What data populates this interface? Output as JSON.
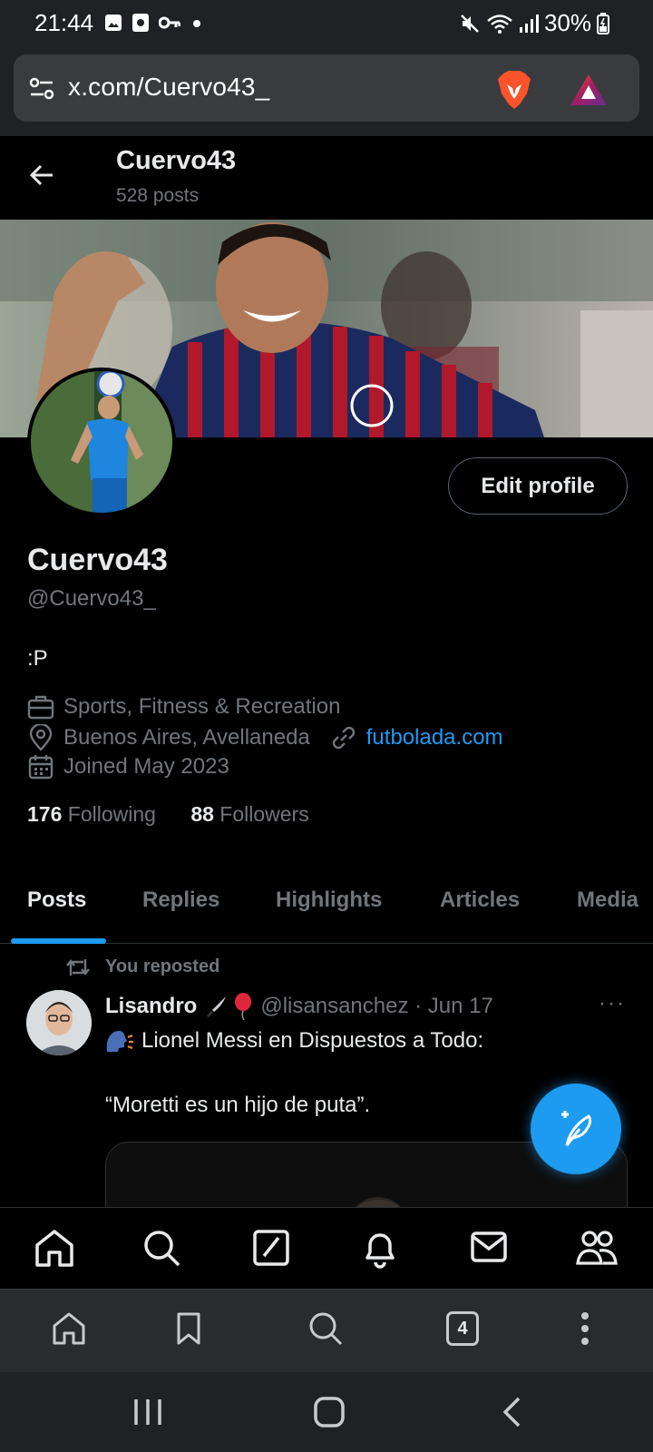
{
  "status_bar": {
    "time": "21:44",
    "battery": "30%"
  },
  "browser": {
    "url": "x.com/Cuervo43_",
    "tab_count": "4"
  },
  "header": {
    "name": "Cuervo43",
    "posts_count": "528 posts"
  },
  "profile": {
    "edit_label": "Edit profile",
    "name": "Cuervo43",
    "handle": "@Cuervo43_",
    "bio": ":P",
    "category": "Sports, Fitness & Recreation",
    "location": "Buenos Aires, Avellaneda",
    "website": "futbolada.com",
    "joined": "Joined May 2023",
    "following_count": "176",
    "following_label": "Following",
    "followers_count": "88",
    "followers_label": "Followers"
  },
  "tabs": [
    "Posts",
    "Replies",
    "Highlights",
    "Articles",
    "Media"
  ],
  "post": {
    "repost_label": "You reposted",
    "author": "Lisandro",
    "handle_date": "@lisansanchez · Jun 17",
    "text_line1": "Lionel Messi en Dispuestos a Todo:",
    "text_line2": "“Moretti es un hijo de puta”.",
    "more": "···"
  },
  "colors": {
    "accent": "#1d9bf0",
    "muted": "#71767b",
    "text": "#e7e9ea"
  },
  "icons": {
    "x_nav": [
      "home-icon",
      "search-icon",
      "grok-icon",
      "notifications-icon",
      "messages-icon",
      "communities-icon"
    ],
    "browser_nav": [
      "home-icon",
      "bookmark-icon",
      "search-icon",
      "tabs-icon",
      "menu-icon"
    ],
    "system_nav": [
      "recents-icon",
      "home-button-icon",
      "back-icon"
    ]
  }
}
